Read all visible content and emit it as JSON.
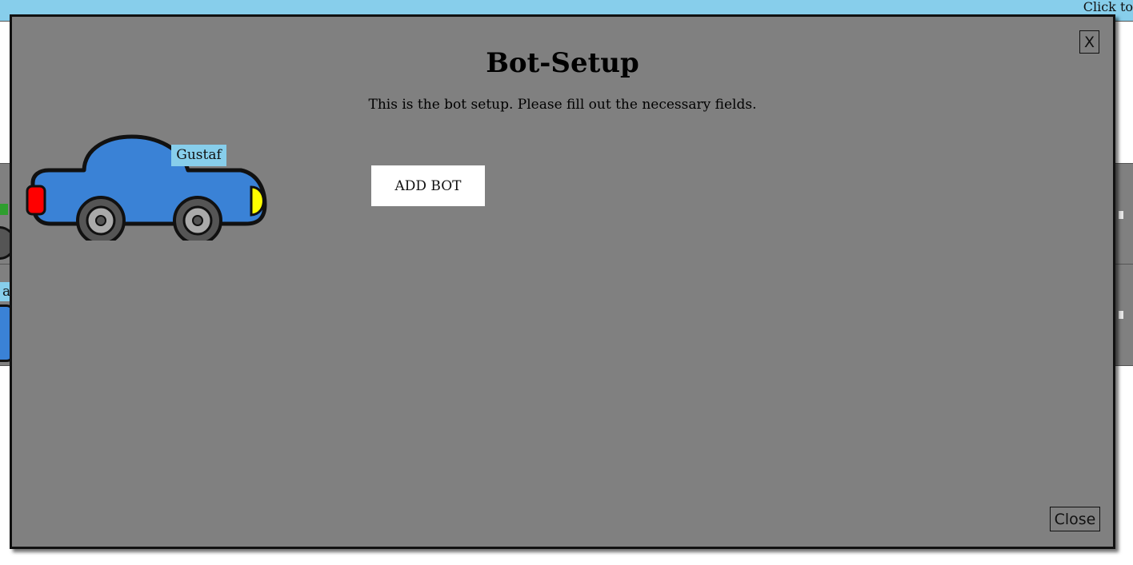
{
  "topbar": {
    "hint": "Click to"
  },
  "background": {
    "label_fragment": "af"
  },
  "modal": {
    "title": "Bot-Setup",
    "description": "This is the bot setup. Please fill out the necessary fields.",
    "close_x": "X",
    "close_label": "Close",
    "add_bot_label": "ADD BOT",
    "bot_name": "Gustaf"
  },
  "colors": {
    "topbar": "#87ceeb",
    "modal_bg": "#808080",
    "car_body": "#3a82d6",
    "tail_light": "#ff0000",
    "head_light": "#ffff00",
    "name_tag": "#87ceeb"
  },
  "icons": {
    "car": "car-icon"
  }
}
